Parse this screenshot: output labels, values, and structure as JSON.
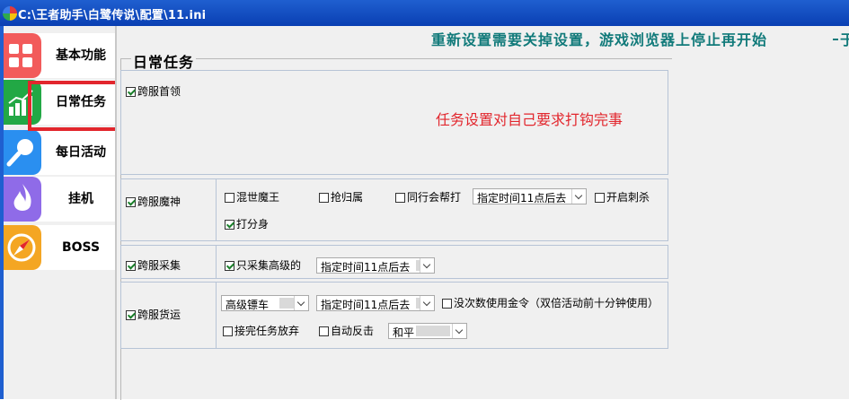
{
  "window": {
    "title": "C:\\王者助手\\白鹭传说\\配置\\11.ini"
  },
  "sidebar": {
    "items": [
      {
        "label": "基本功能",
        "icon": "grid-icon",
        "color": "#f25b5b"
      },
      {
        "label": "日常任务",
        "icon": "bar-chart-icon",
        "color": "#22a845"
      },
      {
        "label": "每日活动",
        "icon": "magnifier-icon",
        "color": "#2a8ff0"
      },
      {
        "label": "挂机",
        "icon": "flame-icon",
        "color": "#8f6be8"
      },
      {
        "label": "BOSS",
        "icon": "compass-icon",
        "color": "#f4a623"
      }
    ]
  },
  "header": {
    "notice": "重新设置需要关掉设置，游戏浏览器上停止再开始",
    "notice_cut": "于"
  },
  "main": {
    "section_title": "日常任务",
    "daily": {
      "label": "跨服首领",
      "checked": true,
      "note": "任务设置对自己要求打钩完事"
    },
    "demon": {
      "label": "跨服魔神",
      "checked": true,
      "options": [
        {
          "label": "混世魔王",
          "checked": false
        },
        {
          "label": "抢归属",
          "checked": false
        },
        {
          "label": "同行会帮打",
          "checked": false
        }
      ],
      "time_select": "指定时间11点后去",
      "slay": {
        "label": "开启刺杀",
        "checked": false
      },
      "clone": {
        "label": "打分身",
        "checked": true
      }
    },
    "gather": {
      "label": "跨服采集",
      "checked": true,
      "high_only": {
        "label": "只采集高级的",
        "checked": true
      },
      "time_select": "指定时间11点后去"
    },
    "cargo": {
      "label": "跨服货运",
      "checked": true,
      "vehicle_select": "高级镖车",
      "time_select": "指定时间11点后去",
      "gold": {
        "label": "没次数使用金令（双倍活动前十分钟使用）",
        "checked": false
      },
      "abandon": {
        "label": "接完任务放弃",
        "checked": false
      },
      "counter": {
        "label": "自动反击",
        "checked": false
      },
      "mode_select": "和平"
    }
  }
}
